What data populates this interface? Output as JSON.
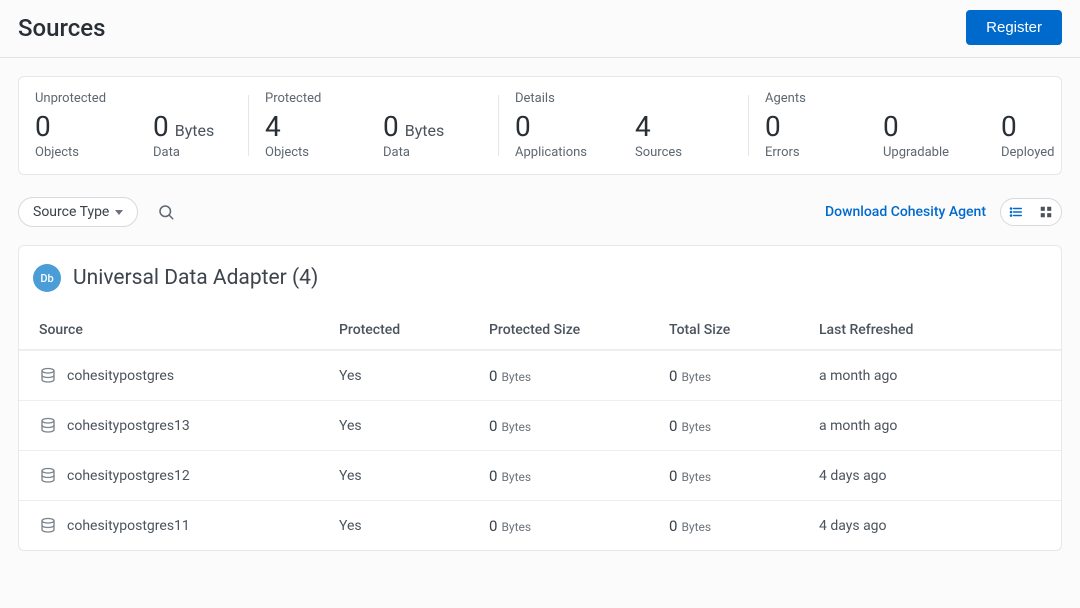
{
  "header": {
    "title": "Sources",
    "register_label": "Register"
  },
  "stats": {
    "unprotected": {
      "label": "Unprotected",
      "objects_value": "0",
      "objects_label": "Objects",
      "data_value": "0",
      "data_unit": "Bytes",
      "data_label": "Data"
    },
    "protected": {
      "label": "Protected",
      "objects_value": "4",
      "objects_label": "Objects",
      "data_value": "0",
      "data_unit": "Bytes",
      "data_label": "Data"
    },
    "details": {
      "label": "Details",
      "applications_value": "0",
      "applications_label": "Applications",
      "sources_value": "4",
      "sources_label": "Sources"
    },
    "agents": {
      "label": "Agents",
      "errors_value": "0",
      "errors_label": "Errors",
      "upgradable_value": "0",
      "upgradable_label": "Upgradable",
      "deployed_value": "0",
      "deployed_label": "Deployed"
    }
  },
  "filters": {
    "source_type_label": "Source Type",
    "download_agent_label": "Download Cohesity Agent"
  },
  "group": {
    "badge": "Db",
    "title": "Universal Data Adapter (4)"
  },
  "table": {
    "headers": {
      "source": "Source",
      "protected": "Protected",
      "protected_size": "Protected Size",
      "total_size": "Total Size",
      "last_refreshed": "Last Refreshed"
    },
    "rows": [
      {
        "source": "cohesitypostgres",
        "protected": "Yes",
        "psize_num": "0",
        "psize_unit": "Bytes",
        "tsize_num": "0",
        "tsize_unit": "Bytes",
        "refreshed": "a month ago"
      },
      {
        "source": "cohesitypostgres13",
        "protected": "Yes",
        "psize_num": "0",
        "psize_unit": "Bytes",
        "tsize_num": "0",
        "tsize_unit": "Bytes",
        "refreshed": "a month ago"
      },
      {
        "source": "cohesitypostgres12",
        "protected": "Yes",
        "psize_num": "0",
        "psize_unit": "Bytes",
        "tsize_num": "0",
        "tsize_unit": "Bytes",
        "refreshed": "4 days ago"
      },
      {
        "source": "cohesitypostgres11",
        "protected": "Yes",
        "psize_num": "0",
        "psize_unit": "Bytes",
        "tsize_num": "0",
        "tsize_unit": "Bytes",
        "refreshed": "4 days ago"
      }
    ]
  }
}
